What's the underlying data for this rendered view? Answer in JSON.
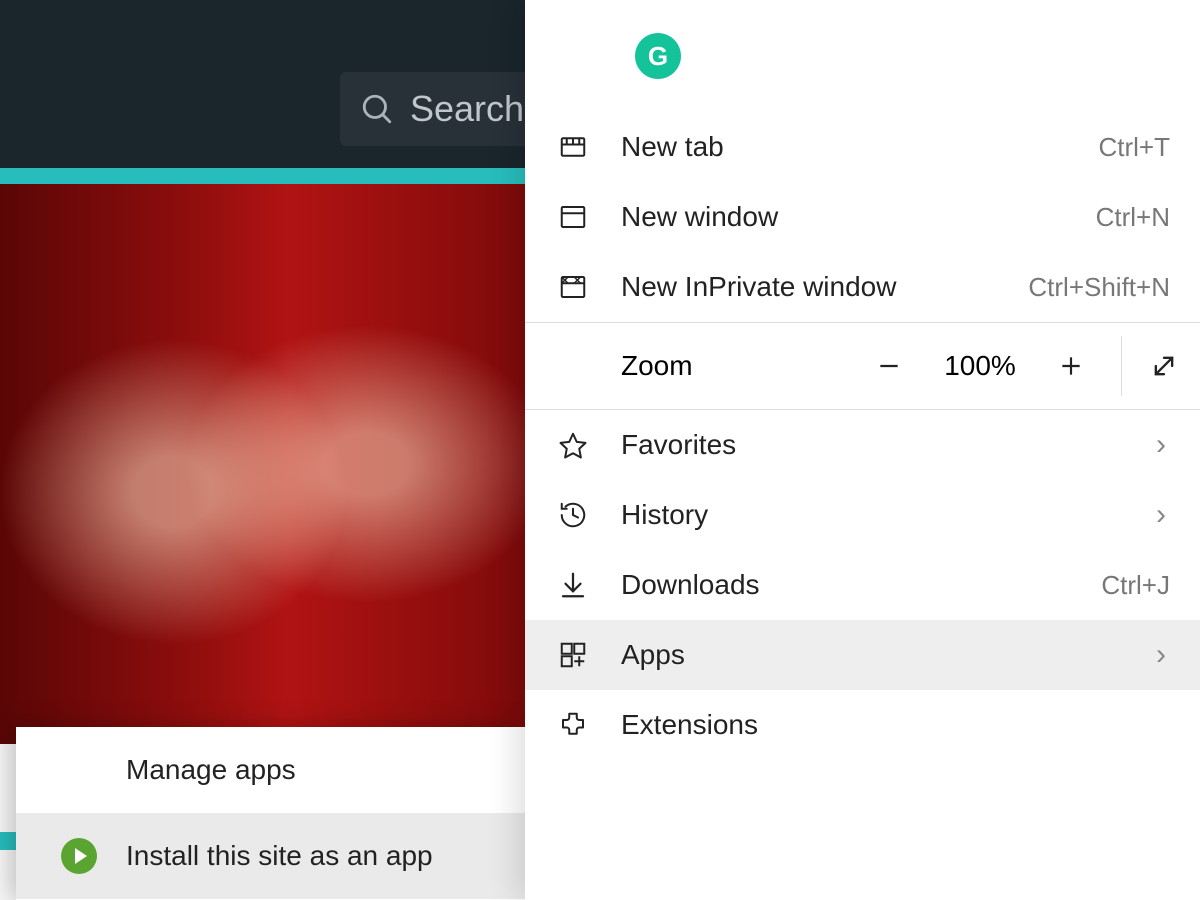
{
  "header": {
    "search_placeholder": "Search"
  },
  "extension_badge": {
    "letter": "G"
  },
  "menu": {
    "new_tab": {
      "label": "New tab",
      "shortcut": "Ctrl+T"
    },
    "new_window": {
      "label": "New window",
      "shortcut": "Ctrl+N"
    },
    "new_inprivate": {
      "label": "New InPrivate window",
      "shortcut": "Ctrl+Shift+N"
    },
    "zoom": {
      "label": "Zoom",
      "value": "100%"
    },
    "favorites": {
      "label": "Favorites"
    },
    "history": {
      "label": "History"
    },
    "downloads": {
      "label": "Downloads",
      "shortcut": "Ctrl+J"
    },
    "apps": {
      "label": "Apps"
    },
    "extensions": {
      "label": "Extensions"
    }
  },
  "apps_submenu": {
    "manage": {
      "label": "Manage apps"
    },
    "install": {
      "label": "Install this site as an app"
    }
  }
}
